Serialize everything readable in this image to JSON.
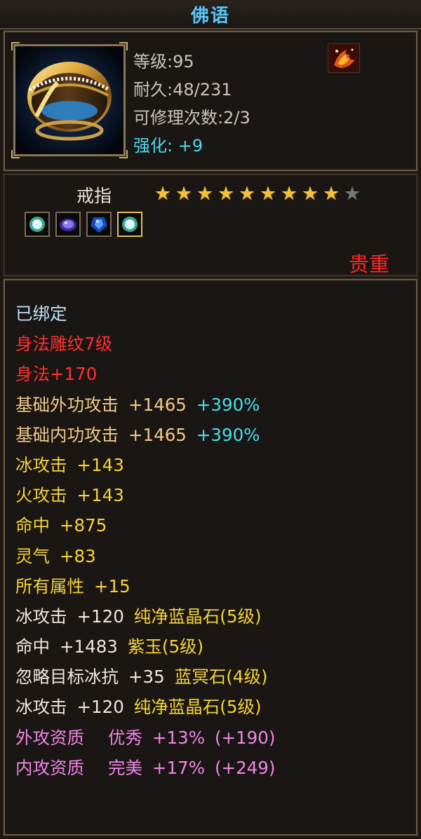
{
  "header": {
    "title": "佛语"
  },
  "item": {
    "icon": "gold-ring-icon",
    "level_label": "等级:",
    "level_value": "95",
    "durability_label": "耐久:",
    "durability_value": "48/231",
    "repair_label": "可修理次数:",
    "repair_value": "2/3",
    "enhance_label": "强化:",
    "enhance_value": "+9",
    "badge_icon": "phoenix-badge-icon"
  },
  "type": {
    "label": "戒指",
    "stars_filled": 9,
    "stars_total": 10,
    "gem_icons": [
      "white-gem-icon",
      "purple-gem-icon",
      "blue-gem-icon",
      "white-gem-icon"
    ],
    "rarity": "贵重"
  },
  "stats": {
    "bound": "已绑定",
    "engraving": "身法雕纹7级",
    "agility": "身法+170",
    "ext_attack": {
      "label": "基础外功攻击",
      "value": "+1465",
      "pct": "+390%"
    },
    "int_attack": {
      "label": "基础内功攻击",
      "value": "+1465",
      "pct": "+390%"
    },
    "ice_attack": {
      "label": "冰攻击",
      "value": "+143"
    },
    "fire_attack": {
      "label": "火攻击",
      "value": "+143"
    },
    "hit": {
      "label": "命中",
      "value": "+875"
    },
    "spirit": {
      "label": "灵气",
      "value": "+83"
    },
    "all_attr": {
      "label": "所有属性",
      "value": "+15"
    },
    "gem1": {
      "label": "冰攻击",
      "value": "+120",
      "gem": "纯净蓝晶石",
      "level": "(5级)"
    },
    "gem2": {
      "label": "命中",
      "value": "+1483",
      "gem": "紫玉",
      "level": "(5级)"
    },
    "gem3": {
      "label": "忽略目标冰抗",
      "value": "+35",
      "gem": "蓝冥石",
      "level": "(4级)"
    },
    "gem4": {
      "label": "冰攻击",
      "value": "+120",
      "gem": "纯净蓝晶石",
      "level": "(5级)"
    },
    "aptitude1": {
      "label": "外攻资质",
      "grade": "优秀",
      "value": "+13%",
      "bonus": "(+190)"
    },
    "aptitude2": {
      "label": "内攻资质",
      "grade": "完美",
      "value": "+17%",
      "bonus": "(+249)"
    }
  }
}
